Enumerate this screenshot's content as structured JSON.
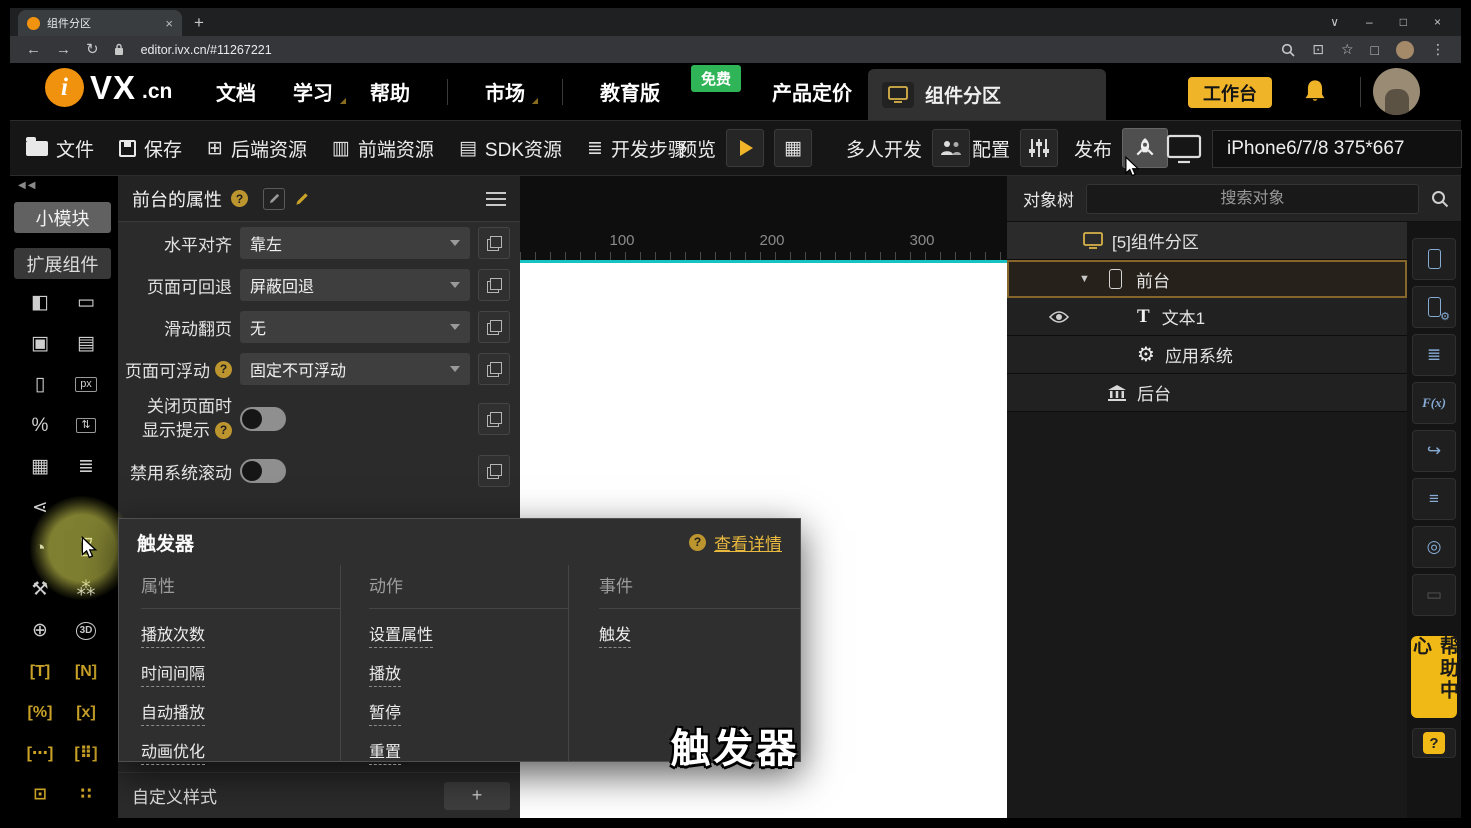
{
  "browser": {
    "tab_title": "组件分区",
    "url": "editor.ivx.cn/#11267221"
  },
  "header": {
    "logo": {
      "i": "i",
      "vx": "VX",
      "cn": ".cn"
    },
    "nav": [
      {
        "label": "文档"
      },
      {
        "label": "学习"
      },
      {
        "label": "帮助"
      },
      {
        "label": "市场"
      },
      {
        "label": "教育版"
      },
      {
        "label": "产品定价"
      }
    ],
    "free_badge": "免费",
    "project_tab": "组件分区",
    "workbench_button": "工作台"
  },
  "toolbar": {
    "file": "文件",
    "save": "保存",
    "backend_res": "后端资源",
    "frontend_res": "前端资源",
    "sdk_res": "SDK资源",
    "dev_steps": "开发步骤",
    "preview": "预览",
    "multi_dev": "多人开发",
    "config": "配置",
    "publish": "发布",
    "device": "iPhone6/7/8 375*667"
  },
  "sidebar": {
    "small_module": "小模块",
    "extended_components": "扩展组件"
  },
  "properties": {
    "title": "前台的属性",
    "rows": [
      {
        "label": "水平对齐",
        "value": "靠左"
      },
      {
        "label": "页面可回退",
        "value": "屏蔽回退"
      },
      {
        "label": "滑动翻页",
        "value": "无"
      },
      {
        "label": "页面可浮动",
        "value": "固定不可浮动"
      },
      {
        "label_line1": "关闭页面时",
        "label_line2": "显示提示"
      },
      {
        "label": "禁用系统滚动"
      }
    ],
    "custom_style": "自定义样式",
    "add_button": "+"
  },
  "trigger_popup": {
    "title": "触发器",
    "help_link": "查看详情",
    "columns": [
      {
        "header": "属性",
        "items": [
          "播放次数",
          "时间间隔",
          "自动播放",
          "动画优化"
        ]
      },
      {
        "header": "动作",
        "items": [
          "设置属性",
          "播放",
          "暂停",
          "重置"
        ]
      },
      {
        "header": "事件",
        "items": [
          "触发"
        ]
      }
    ]
  },
  "canvas": {
    "ruler_marks": [
      "100",
      "200",
      "300"
    ]
  },
  "object_tree": {
    "title": "对象树",
    "search_placeholder": "搜索对象",
    "items": [
      {
        "label": "[5]组件分区"
      },
      {
        "label": "前台"
      },
      {
        "label": "文本1"
      },
      {
        "label": "应用系统"
      },
      {
        "label": "后台"
      }
    ]
  },
  "help_center": {
    "label": "帮助中心"
  },
  "caption": "触发器",
  "colors": {
    "accent_gold": "#f0b429",
    "free_green": "#2fb457",
    "selection_teal": "#16c2c2",
    "tree_selected_border": "#87662b",
    "link_gold": "#e8b93e"
  },
  "icons": {
    "close": "×",
    "plus": "+",
    "minimize": "–",
    "maximize": "□",
    "chevron_down": "∨",
    "back": "←",
    "forward": "→",
    "refresh": "↻",
    "star": "☆",
    "more": "⋮",
    "install": "⊡",
    "collapse": "◀◀",
    "nav_caret": "◢",
    "question": "?",
    "expander": "▼",
    "tb_backend": "⊞",
    "tb_frontend": "▥",
    "tb_sdk": "▤",
    "tb_steps": "≣",
    "tb_qr": "▦",
    "g_media1": "◧",
    "g_media2": "▭",
    "g_frame": "▣",
    "g_input": "▤",
    "g_mobile": "▯",
    "g_px": "px",
    "g_percent": "%",
    "g_vslider": "⇅",
    "g_table": "▦",
    "g_list": "≣",
    "g_node": "⋖",
    "g_clock": "◔",
    "g_tool": "⚒",
    "g_sitemap": "⁂",
    "g_steer": "⊕",
    "g_3d": "3D",
    "g_t": "[T]",
    "g_n": "[N]",
    "g_pct": "[%]",
    "g_x": "[x]",
    "g_dots": "[⋯]",
    "g_grid": "[⠿]",
    "g_box": "⊡",
    "g_cluster": "∷",
    "rc_books": "≣",
    "rc_fx": "F(x)",
    "rc_exit": "↪",
    "rc_layers": "≡",
    "rc_gauge": "◎",
    "rc_panel": "▭",
    "tree_t": "T",
    "tree_gear": "⚙"
  }
}
